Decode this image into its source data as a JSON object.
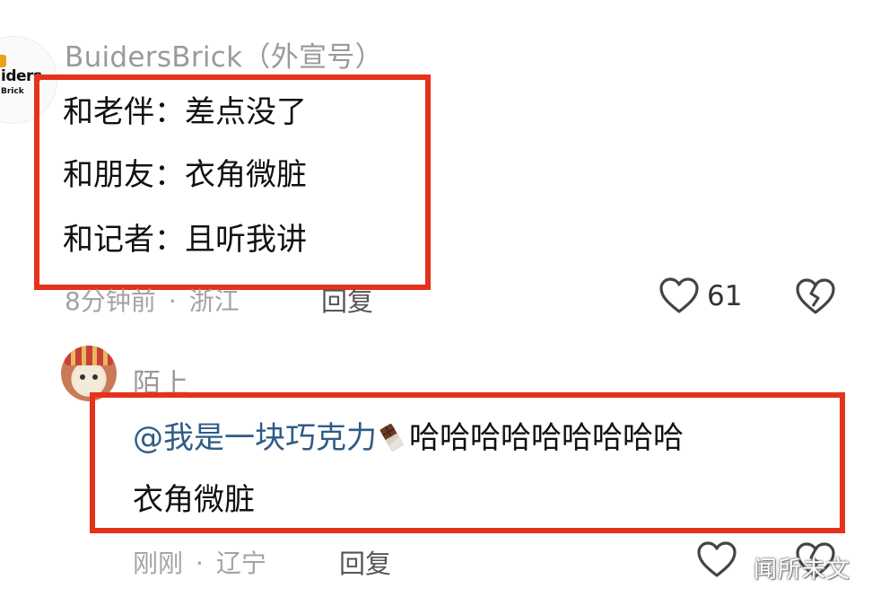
{
  "comment1": {
    "username": "BuidersBrick（外宣号）",
    "avatar_text": "iders",
    "avatar_subtext": "Brick",
    "lines": [
      "和老伴：差点没了",
      "和朋友：衣角微脏",
      "和记者：且听我讲"
    ],
    "time": "8分钟前",
    "location": "浙江",
    "reply_label": "回复",
    "like_count": "61",
    "icons": {
      "like": "heart-outline-icon",
      "dislike": "broken-heart-icon"
    }
  },
  "comment2": {
    "username": "陌上",
    "mention": "@我是一块巧克力",
    "emoji": "chocolate-bar-emoji",
    "laugh": "哈哈哈哈哈哈哈哈哈",
    "line2": "衣角微脏",
    "time": "刚刚",
    "location": "辽宁",
    "reply_label": "回复"
  },
  "watermark": "闻所未文",
  "colors": {
    "highlight_border": "#e4321b",
    "mention": "#2f5b87",
    "meta": "#a3a3a3"
  }
}
